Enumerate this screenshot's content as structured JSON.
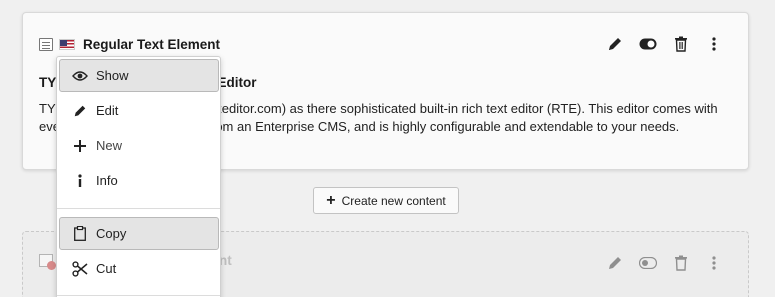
{
  "card": {
    "title": "Regular Text Element",
    "body_head": "TYPO3 CMS comes with CKEditor",
    "body_text": "TYPO3 CMS uses CKEditor (ckeditor.com) as there sophisticated built-in rich text editor (RTE). This editor comes with everything one would expect from an Enterprise CMS, and is highly configurable and extendable to your needs."
  },
  "create_button": {
    "label": "Create new content"
  },
  "card2": {
    "title_fragment": "nt"
  },
  "menu": {
    "items": [
      {
        "label": "Show",
        "icon": "eye-icon",
        "highlighted": true
      },
      {
        "label": "Edit",
        "icon": "pencil-icon",
        "highlighted": false
      },
      {
        "label": "New",
        "icon": "plus-icon",
        "highlighted": false
      },
      {
        "label": "Info",
        "icon": "info-icon",
        "highlighted": false
      },
      {
        "label": "Copy",
        "icon": "clipboard-icon",
        "highlighted": true
      },
      {
        "label": "Cut",
        "icon": "scissors-icon",
        "highlighted": false
      }
    ]
  },
  "colors": {
    "background": "#f0f0f0",
    "card": "#fafafa",
    "highlight": "#e4e4e4",
    "stop": "#c83c3c"
  }
}
